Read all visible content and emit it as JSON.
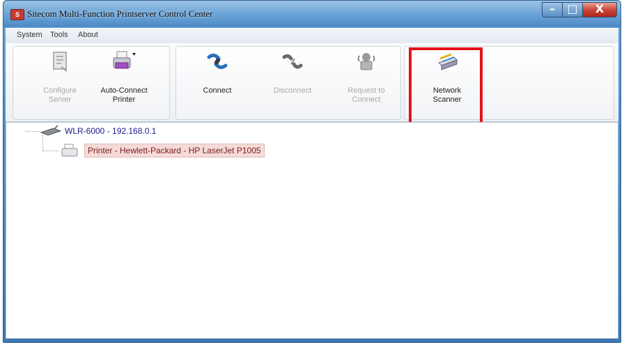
{
  "window": {
    "title": "Sitecom Multi-Function Printserver Control Center",
    "app_icon_text": "S",
    "min_glyph": "–",
    "max_glyph": "□",
    "close_glyph": "X"
  },
  "menu": {
    "items": [
      "System",
      "Tools",
      "About"
    ]
  },
  "toolbar": {
    "buttons": [
      {
        "label_line1": "Configure",
        "label_line2": "Server",
        "icon": "configure-server-icon",
        "enabled": false
      },
      {
        "label_line1": "Auto-Connect",
        "label_line2": "Printer",
        "icon": "printer-icon",
        "enabled": true
      },
      {
        "label_line1": "Connect",
        "label_line2": "",
        "icon": "connect-icon",
        "enabled": true
      },
      {
        "label_line1": "Disconnect",
        "label_line2": "",
        "icon": "disconnect-icon",
        "enabled": false
      },
      {
        "label_line1": "Request to",
        "label_line2": "Connect",
        "icon": "request-connect-icon",
        "enabled": false
      },
      {
        "label_line1": "Network",
        "label_line2": "Scanner",
        "icon": "scanner-icon",
        "enabled": true
      }
    ]
  },
  "tree": {
    "server_node": "WLR-6000 - 192.168.0.1",
    "printer_node": "Printer - Hewlett-Packard - HP LaserJet P1005"
  },
  "colors": {
    "highlight_box": "#e2141a",
    "selection_bg": "#f5dbd8",
    "title_bar": "#6ea6d8"
  }
}
